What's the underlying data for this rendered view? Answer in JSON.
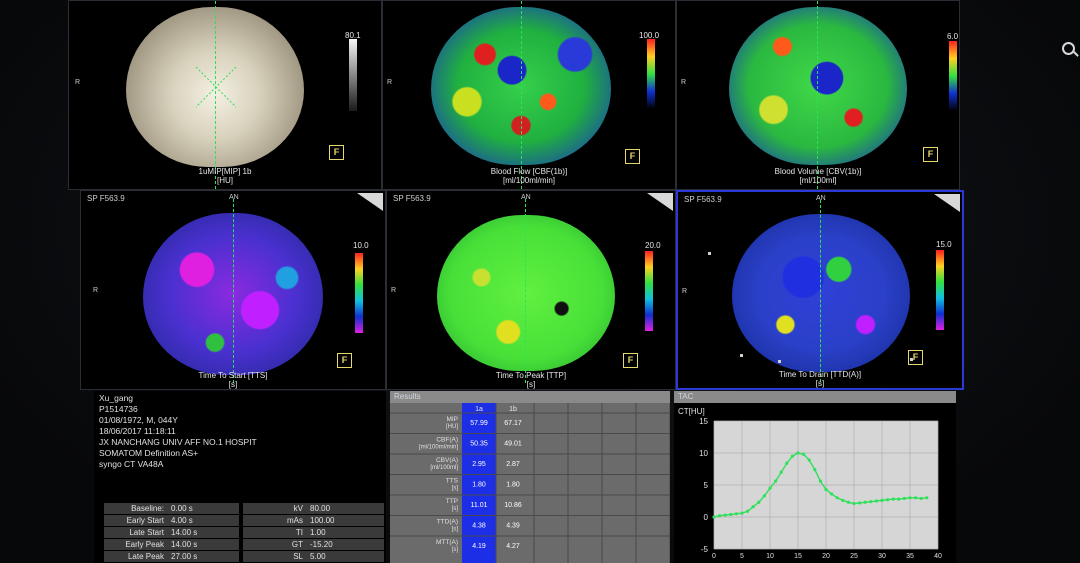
{
  "window": {
    "top_marker": "■"
  },
  "colors": {
    "green_line": "#2fe05a",
    "active_border": "#2a39d8",
    "results_col_highlight": "#1c2fe6",
    "scale_icon_yellow": "#e6d86a"
  },
  "top_row": [
    {
      "caption_line1": "1uMIP[MIP] 1b",
      "caption_line2": "[HU]",
      "scale_max": "80.1",
      "orient_left": "R"
    },
    {
      "caption_line1": "Blood Flow [CBF(1b)]",
      "caption_line2": "[ml/100ml/min]",
      "scale_max": "100.0",
      "orient_left": "R"
    },
    {
      "caption_line1": "Blood Volume [CBV(1b)]",
      "caption_line2": "[ml/100ml]",
      "scale_max": "6.0",
      "orient_left": "R"
    }
  ],
  "bottom_row": [
    {
      "sp_label": "SP F563.9",
      "orient_top": "AN",
      "orient_left": "R",
      "caption_line1": "Time To Start [TTS]",
      "caption_line2": "[s]",
      "scale_max": "10.0"
    },
    {
      "sp_label": "SP F563.9",
      "orient_top": "AN",
      "orient_left": "R",
      "caption_line1": "Time To Peak [TTP]",
      "caption_line2": "[s]",
      "scale_max": "20.0"
    },
    {
      "sp_label": "SP F563.9",
      "orient_top": "AN",
      "orient_left": "R",
      "caption_line1": "Time To Drain [TTD(A)]",
      "caption_line2": "[s]",
      "scale_max": "15.0"
    }
  ],
  "patient": {
    "name": "Xu_gang",
    "id": "P1514736",
    "dob_sex_age": "01/08/1972, M, 044Y",
    "datetime": "18/06/2017 11:18:11",
    "institution": "JX NANCHANG UNIV AFF NO.1 HOSPIT",
    "scanner": "SOMATOM Definition AS+",
    "software": "syngo CT VA48A"
  },
  "params": [
    {
      "label": "Baseline:",
      "value": "0.00 s",
      "label2": "kV",
      "value2": "80.00"
    },
    {
      "label": "Early Start",
      "value": "4.00 s",
      "label2": "mAs",
      "value2": "100.00"
    },
    {
      "label": "Late Start",
      "value": "14.00 s",
      "label2": "TI",
      "value2": "1.00"
    },
    {
      "label": "Early Peak",
      "value": "14.00 s",
      "label2": "GT",
      "value2": "-15.20"
    },
    {
      "label": "Late Peak",
      "value": "27.00 s",
      "label2": "SL",
      "value2": "5.00"
    }
  ],
  "results": {
    "title": "Results",
    "col_headers": [
      "1a",
      "1b"
    ],
    "rows": [
      {
        "label1": "MIP",
        "label2": "[HU]",
        "v1": "57.99",
        "v2": "67.17"
      },
      {
        "label1": "CBF(A)",
        "label2": "[ml/100ml/min]",
        "v1": "50.35",
        "v2": "49.01"
      },
      {
        "label1": "CBV(A)",
        "label2": "[ml/100ml]",
        "v1": "2.95",
        "v2": "2.87"
      },
      {
        "label1": "TTS",
        "label2": "[s]",
        "v1": "1.80",
        "v2": "1.80"
      },
      {
        "label1": "TTP",
        "label2": "[s]",
        "v1": "11.01",
        "v2": "10.86"
      },
      {
        "label1": "TTD(A)",
        "label2": "[s]",
        "v1": "4.38",
        "v2": "4.39"
      },
      {
        "label1": "MTT(A)",
        "label2": "[s]",
        "v1": "4.19",
        "v2": "4.27"
      }
    ]
  },
  "tac": {
    "title": "TAC",
    "ylabel": "CT[HU]"
  },
  "chart_data": {
    "type": "line",
    "xlabel": "",
    "ylabel": "CT[HU]",
    "xlim": [
      0,
      40
    ],
    "ylim": [
      -5,
      15
    ],
    "x_ticks": [
      "0",
      "5",
      "10",
      "15",
      "20",
      "25",
      "30",
      "35",
      "40"
    ],
    "y_ticks": [
      "15",
      "10",
      "5",
      "0",
      "-5"
    ],
    "series": [
      {
        "x": [
          0,
          1,
          2,
          3,
          4,
          5,
          6,
          7,
          8,
          9,
          10,
          11,
          12,
          13,
          14,
          15,
          16,
          17,
          18,
          19,
          20,
          21,
          22,
          23,
          24,
          25,
          26,
          27,
          28,
          29,
          30,
          31,
          32,
          33,
          34,
          35,
          36,
          37,
          38
        ],
        "values": [
          0.0,
          0.2,
          0.3,
          0.4,
          0.5,
          0.6,
          0.9,
          1.6,
          2.3,
          3.3,
          4.5,
          5.6,
          7.0,
          8.4,
          9.5,
          10.0,
          9.8,
          8.9,
          7.4,
          5.6,
          4.3,
          3.6,
          3.0,
          2.6,
          2.3,
          2.1,
          2.2,
          2.3,
          2.4,
          2.5,
          2.6,
          2.7,
          2.8,
          2.8,
          2.9,
          3.0,
          3.0,
          2.9,
          3.0
        ]
      }
    ]
  }
}
